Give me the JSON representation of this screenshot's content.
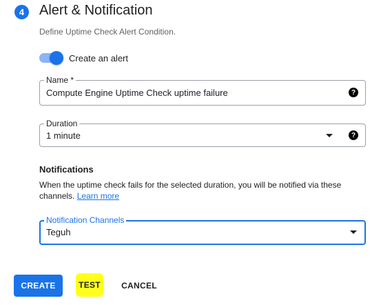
{
  "section": {
    "step_number": "4",
    "title": "Alert & Notification",
    "description": "Define Uptime Check Alert Condition."
  },
  "alert_toggle": {
    "label": "Create an alert",
    "enabled": true
  },
  "name_field": {
    "label": "Name *",
    "value": "Compute Engine Uptime Check uptime failure",
    "help_icon": "help-icon"
  },
  "duration_field": {
    "label": "Duration",
    "value": "1 minute",
    "help_icon": "help-icon"
  },
  "notifications": {
    "heading": "Notifications",
    "description": "When the uptime check fails for the selected duration, you will be notified via these channels.",
    "link_text": "Learn more"
  },
  "channels_field": {
    "label": "Notification Channels",
    "value": "Teguh"
  },
  "actions": {
    "create_label": "CREATE",
    "test_label": "TEST",
    "cancel_label": "CANCEL"
  },
  "colors": {
    "accent": "#1a73e8",
    "highlight": "#ffff1c"
  }
}
